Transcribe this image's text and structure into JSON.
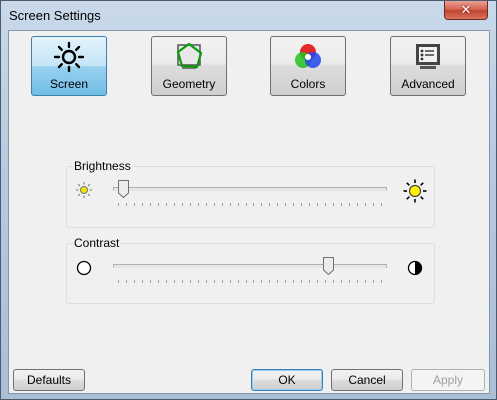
{
  "window": {
    "title": "Screen Settings",
    "close_glyph": "✕"
  },
  "tabs": [
    {
      "label": "Screen",
      "icon": "sun-icon",
      "active": true
    },
    {
      "label": "Geometry",
      "icon": "geometry-icon",
      "active": false
    },
    {
      "label": "Colors",
      "icon": "rgb-circles-icon",
      "active": false
    },
    {
      "label": "Advanced",
      "icon": "monitor-panel-icon",
      "active": false
    }
  ],
  "brightness": {
    "label": "Brightness",
    "value": 0.02,
    "min_icon": "dim-sun-icon",
    "max_icon": "bright-sun-icon"
  },
  "contrast": {
    "label": "Contrast",
    "value": 0.8,
    "min_icon": "empty-circle-icon",
    "max_icon": "half-circle-icon"
  },
  "buttons": {
    "defaults": "Defaults",
    "ok": "OK",
    "cancel": "Cancel",
    "apply": "Apply"
  },
  "colors": {
    "accent": "#3c7fb1",
    "close": "#c24531",
    "sun": "#f5e400"
  }
}
